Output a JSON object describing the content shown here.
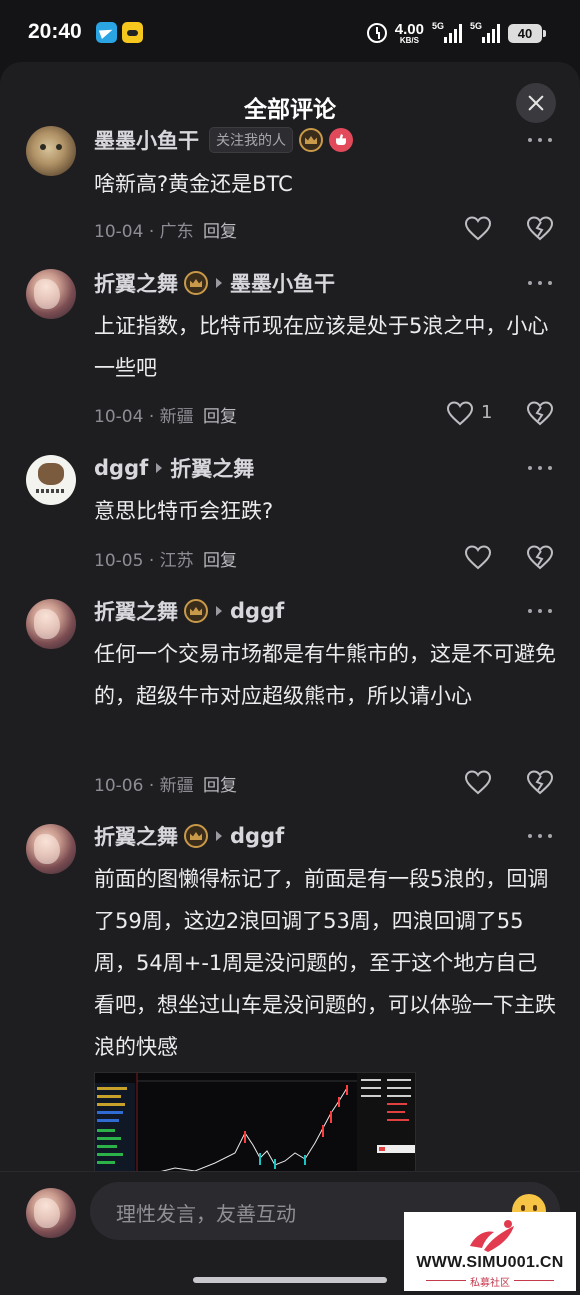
{
  "status_bar": {
    "time": "20:40",
    "net_speed": "4.00",
    "net_unit": "KB/S",
    "signal_1": "5G",
    "signal_2": "5G",
    "battery": "40"
  },
  "sheet": {
    "title": "全部评论",
    "close_icon": "close-icon"
  },
  "comments": [
    {
      "author": "墨墨小鱼干",
      "tag": "关注我的人",
      "text": "啥新高?黄金还是BTC",
      "date": "10-04",
      "location": "广东",
      "reply_label": "回复",
      "likes": ""
    },
    {
      "author": "折翼之舞",
      "reply_to": "墨墨小鱼干",
      "text": "上证指数，比特币现在应该是处于5浪之中，小心一些吧",
      "date": "10-04",
      "location": "新疆",
      "reply_label": "回复",
      "likes": "1"
    },
    {
      "author": "dggf",
      "reply_to": "折翼之舞",
      "text": "意思比特币会狂跌?",
      "date": "10-05",
      "location": "江苏",
      "reply_label": "回复",
      "likes": ""
    },
    {
      "author": "折翼之舞",
      "reply_to": "dggf",
      "text": "任何一个交易市场都是有牛熊市的，这是不可避免的，超级牛市对应超级熊市，所以请小心",
      "date": "10-06",
      "location": "新疆",
      "reply_label": "回复",
      "likes": ""
    },
    {
      "author": "折翼之舞",
      "reply_to": "dggf",
      "text": "前面的图懒得标记了，前面是有一段5浪的，回调了59周，这边2浪回调了53周，四浪回调了55周，54周+-1周是没问题的，至于这个地方自己看吧，想坐过山车是没问题的，可以体验一下主跌浪的快感",
      "date": "",
      "location": "",
      "reply_label": "",
      "likes": ""
    }
  ],
  "meta_sep": "·",
  "input": {
    "placeholder": "理性发言，友善互动"
  },
  "watermark": {
    "url": "WWW.SIMU001.CN",
    "subtitle": "私募社区"
  },
  "colors": {
    "background": "#141416",
    "sheet": "#1e1e21",
    "text": "#ececef",
    "muted": "#8d8d94",
    "accent_red": "#e24a5c",
    "crown_gold": "#c99a4a"
  }
}
